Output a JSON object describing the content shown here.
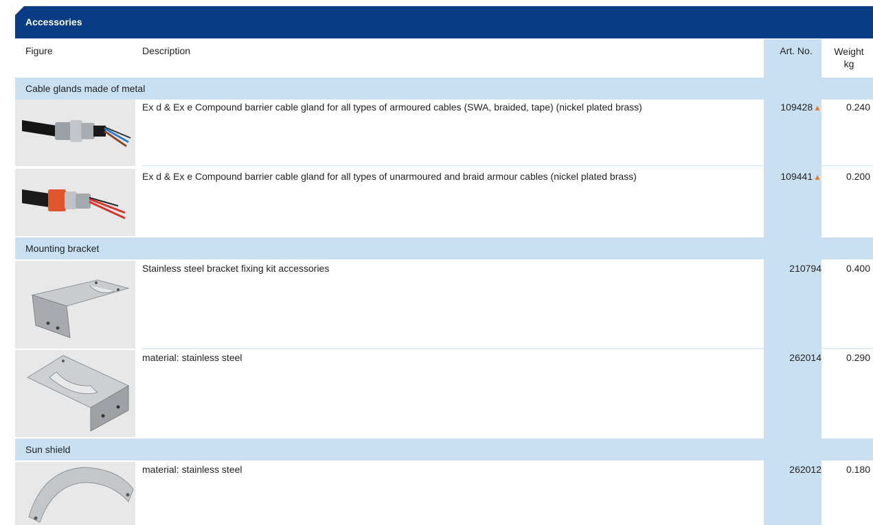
{
  "header": {
    "title": "Accessories"
  },
  "columns": {
    "figure": "Figure",
    "description": "Description",
    "art_no": "Art. No.",
    "weight_line1": "Weight",
    "weight_line2": "kg"
  },
  "sections": [
    {
      "title": "Cable glands made of metal"
    },
    {
      "title": "Mounting bracket"
    },
    {
      "title": "Sun shield"
    }
  ],
  "rows": [
    {
      "description": "Ex d & Ex e Compound barrier cable gland for all types of armoured cables (SWA, braided, tape) (nickel plated brass)",
      "art_no": "109428",
      "marker": "▲",
      "weight": "0.240",
      "figure_icon": "cable-gland-armoured"
    },
    {
      "description": "Ex d & Ex e Compound barrier cable gland for all types of unarmoured and braid armour cables (nickel plated brass)",
      "art_no": "109441",
      "marker": "▲",
      "weight": "0.200",
      "figure_icon": "cable-gland-unarmoured"
    },
    {
      "description": "Stainless steel bracket fixing kit accessories",
      "art_no": "210794",
      "weight": "0.400",
      "figure_icon": "mounting-bracket"
    },
    {
      "description": "material: stainless steel",
      "art_no": "262014",
      "weight": "0.290",
      "figure_icon": "mounting-bracket-angled"
    },
    {
      "description": "material: stainless steel",
      "art_no": "262012",
      "weight": "0.180",
      "figure_icon": "sun-shield"
    }
  ],
  "colors": {
    "header_bg": "#083c84",
    "section_bg": "#c9e0f3",
    "art_col_bg": "#c9e0f3",
    "marker": "#ef7b22",
    "figure_bg": "#e8e8e8"
  }
}
